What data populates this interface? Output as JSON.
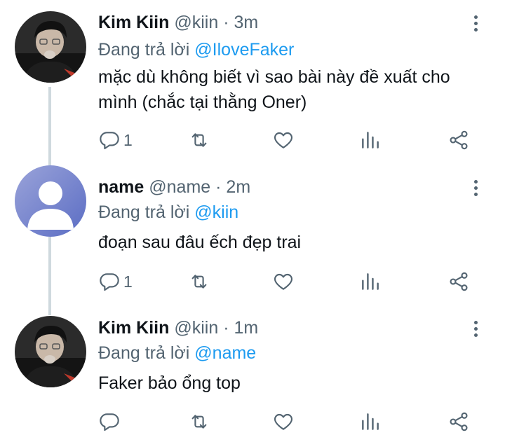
{
  "icons": {
    "reply": "reply-icon",
    "retweet": "retweet-icon",
    "like": "like-icon",
    "stats": "stats-icon",
    "share": "share-icon",
    "more": "more-icon"
  },
  "colors": {
    "mention": "#1d9bf0",
    "secondary": "#536471",
    "thread_line": "#cfd9de"
  },
  "tweets": [
    {
      "name": "Kim Kiin",
      "handle": "@kiin",
      "separator": "·",
      "time": "3m",
      "reply_prefix": "Đang trả lời",
      "reply_to": "@IloveFaker",
      "text": "mặc dù không biết vì sao bài này đề xuất cho mình (chắc tại thằng Oner)",
      "reply_count": "1"
    },
    {
      "name": "name",
      "handle": "@name",
      "separator": "·",
      "time": "2m",
      "reply_prefix": "Đang trả lời",
      "reply_to": "@kiin",
      "text": "đoạn sau đâu ếch đẹp trai",
      "reply_count": "1"
    },
    {
      "name": "Kim Kiin",
      "handle": "@kiin",
      "separator": "·",
      "time": "1m",
      "reply_prefix": "Đang trả lời",
      "reply_to": "@name",
      "text": "Faker bảo ổng top",
      "reply_count": ""
    }
  ]
}
